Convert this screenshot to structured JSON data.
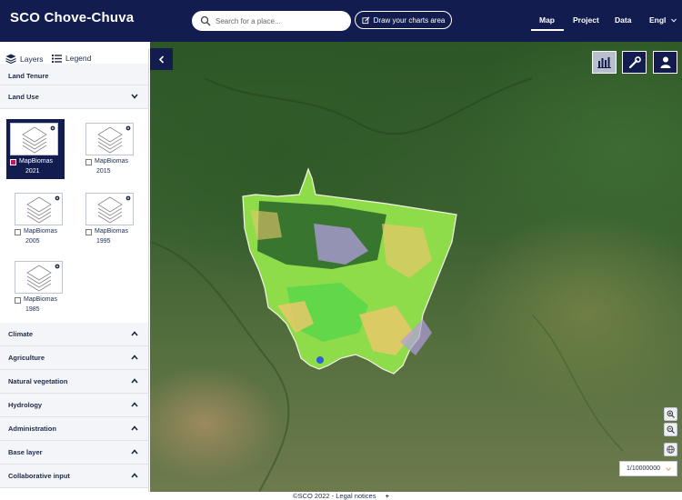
{
  "header": {
    "app_title": "SCO Chove-Chuva",
    "search_placeholder": "Search for a place...",
    "draw_button_label": "Draw your charts area",
    "nav": {
      "map": "Map",
      "project": "Project",
      "data": "Data",
      "language": "Engl"
    }
  },
  "sidebar": {
    "tabs": {
      "layers": "Layers",
      "legend": "Legend"
    },
    "sections": {
      "land_tenure": "Land Tenure",
      "land_use": "Land Use",
      "climate": "Climate",
      "agriculture": "Agriculture",
      "natural_vegetation": "Natural vegetation",
      "hydrology": "Hydrology",
      "administration": "Administration",
      "base_layer": "Base layer",
      "collaborative_input": "Collaborative input"
    },
    "layers": [
      {
        "name": "MapBiomas",
        "year": "2021",
        "checked": true
      },
      {
        "name": "MapBiomas",
        "year": "2015",
        "checked": false
      },
      {
        "name": "MapBiomas",
        "year": "2005",
        "checked": false
      },
      {
        "name": "MapBiomas",
        "year": "1995",
        "checked": false
      },
      {
        "name": "MapBiomas",
        "year": "1985",
        "checked": false
      }
    ]
  },
  "map": {
    "scale": "1/10000000"
  },
  "footer": {
    "text": "©SCO 2022 - Legal notices",
    "plus": "+"
  },
  "colors": {
    "header_bg": "#121c4f",
    "selected_card_bg": "#121c4f",
    "checkbox_on": "#c2185b",
    "map_forest": "#2d5626"
  }
}
